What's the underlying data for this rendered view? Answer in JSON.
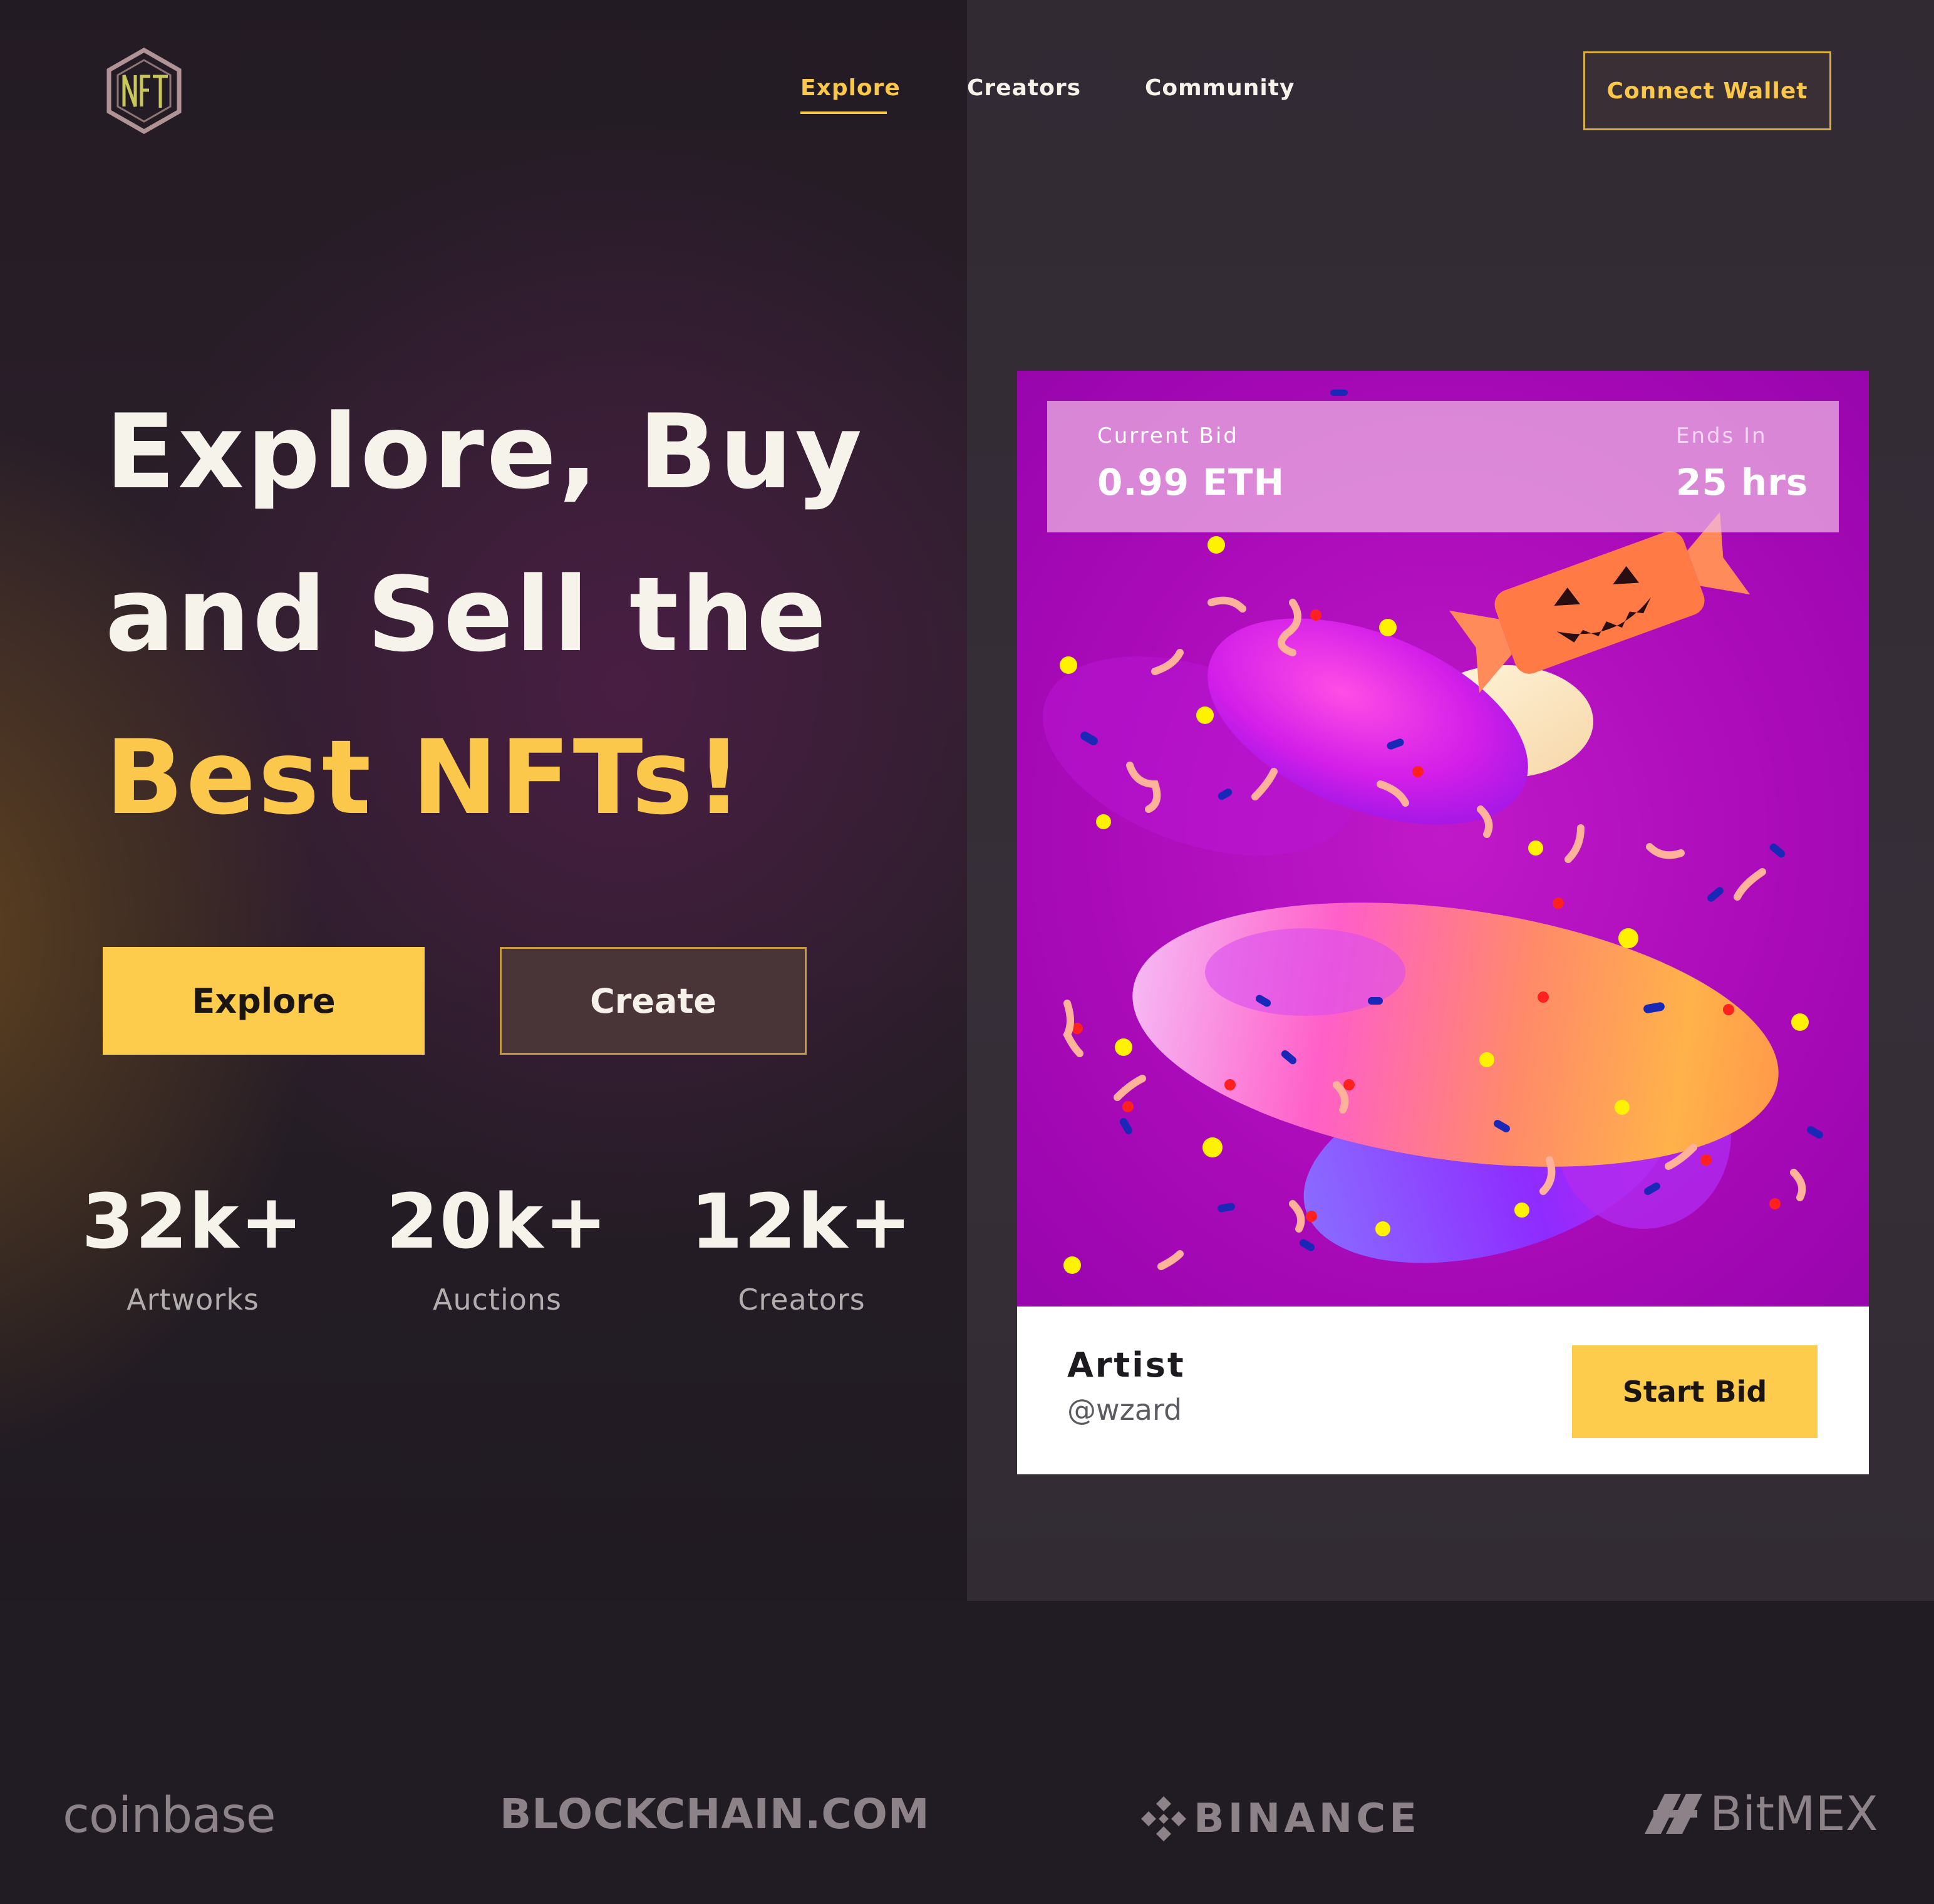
{
  "logo": {
    "icon": "nft-hexagon-logo",
    "text": "NFT"
  },
  "nav": {
    "items": [
      {
        "label": "Explore",
        "active": true
      },
      {
        "label": "Creators",
        "active": false
      },
      {
        "label": "Community",
        "active": false
      }
    ],
    "connect_label": "Connect Wallet"
  },
  "hero": {
    "line1": "Explore, Buy",
    "line2": "and Sell the",
    "line3": "Best NFTs!",
    "explore_label": "Explore",
    "create_label": "Create"
  },
  "stats": [
    {
      "value": "32k+",
      "label": "Artworks"
    },
    {
      "value": "20k+",
      "label": "Auctions"
    },
    {
      "value": "12k+",
      "label": "Creators"
    }
  ],
  "card": {
    "bid_label": "Current Bid",
    "bid_value": "0.99 ETH",
    "ends_label": "Ends In",
    "ends_value": "25 hrs",
    "artist_label": "Artist",
    "artist_handle": "@wzard",
    "start_bid_label": "Start Bid"
  },
  "partners": [
    {
      "name": "coinbase",
      "icon": "coinbase-logo"
    },
    {
      "name": "BLOCKCHAIN.COM",
      "icon": "blockchain-logo"
    },
    {
      "name": "BINANCE",
      "icon": "binance-diamond-icon"
    },
    {
      "name": "BitMEX",
      "icon": "bitmex-slash-icon"
    }
  ],
  "colors": {
    "accent": "#fdcc4d",
    "background": "#211b23",
    "panel": "#352d36",
    "art_magenta": "#aa0cb8"
  }
}
